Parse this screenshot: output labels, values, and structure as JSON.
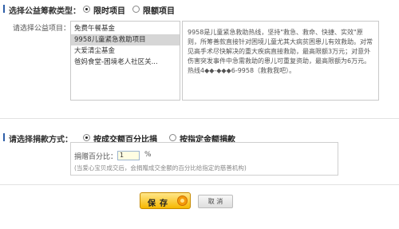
{
  "section1": {
    "title": "选择公益筹款类型：",
    "options": [
      {
        "label": "限时项目",
        "selected": true
      },
      {
        "label": "限额项目",
        "selected": false
      }
    ],
    "select_label": "请选择公益项目：",
    "projects": [
      "免费午餐基金",
      "9958儿童紧急救助项目",
      "大爱清尘基金",
      "爸妈食堂-困境老人社区关..."
    ],
    "selected_index": 1,
    "description": "9958是儿童紧急救助热线，坚持\"救急、救命、快捷、实效\"原则，所筹善款直接针对困境儿童尤其大病贫困患儿有效救助。对常见高手术尽快解决的重大疾病直接救助，最高限额3万元；对意外伤害突发事件中急需救助的患儿可重复资助，最高限额为6万元。热线4◆◆-◆◆◆6-9958（救救我吧）。"
  },
  "section2": {
    "title": "请选择捐款方式：",
    "options": [
      {
        "label": "按成交额百分比捐款",
        "selected": true
      },
      {
        "label": "按指定金额捐款",
        "selected": false
      }
    ],
    "percent_label": "捐赠百分比：",
    "percent_value": "1",
    "percent_unit": "%",
    "hint": "(当爱心宝贝成交后，会捐赠成交金额的百分比给指定的慈善机构)"
  },
  "actions": {
    "save_label": "保存",
    "cancel_label": "取 消"
  },
  "colors": {
    "accent": "#2f5fa8",
    "save_button": "#f6b800",
    "selected_row": "#d6d6d6"
  },
  "icons": [
    "radio-icon",
    "coin-icon"
  ]
}
